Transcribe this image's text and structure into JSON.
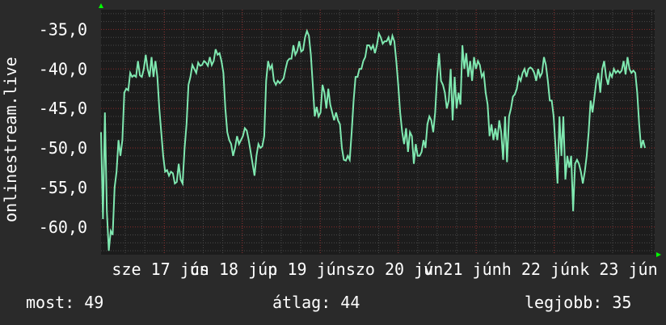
{
  "chart_data": {
    "type": "line",
    "ylabel": "onlinestream.live",
    "ylim": [
      -63.5,
      -32.5
    ],
    "y_ticks": [
      -35,
      -40,
      -45,
      -50,
      -55,
      -60
    ],
    "y_tick_labels": [
      "-35,0",
      "-40,0",
      "-45,0",
      "-50,0",
      "-55,0",
      "-60,0"
    ],
    "x_tick_labels": [
      "sze 17 jún",
      "cs 18 jún",
      "p 19 jún",
      "szo 20 jún",
      "v 21 jún",
      "h 22 jún",
      "k 23 jún"
    ],
    "grid": true,
    "colors": {
      "background": "#2a2a2a",
      "plot": "#1c1c1c",
      "grid": "#4a4a4a",
      "minor_grid": "#8a2a2a",
      "line": "#7fe8b0",
      "arrow": "#00ff00"
    },
    "series": [
      {
        "values": [
          -48,
          -59,
          -45.5,
          -58,
          -63,
          -60.5,
          -61,
          -55,
          -53,
          -49,
          -51,
          -49,
          -43,
          -42.5,
          -42.7,
          -40.5,
          -41,
          -40.8,
          -41,
          -39,
          -40.8,
          -41,
          -40,
          -38.2,
          -40,
          -41,
          -38.5,
          -41,
          -39,
          -41,
          -45,
          -48,
          -51,
          -53,
          -52.8,
          -53.5,
          -53,
          -53.2,
          -54.5,
          -54.3,
          -52,
          -54,
          -54.5,
          -50,
          -47,
          -42,
          -41,
          -39.5,
          -40,
          -40.5,
          -39.2,
          -39.6,
          -39.5,
          -39,
          -39.2,
          -39.6,
          -38.5,
          -39.5,
          -39,
          -37.5,
          -38.2,
          -38,
          -39,
          -40.5,
          -45,
          -48,
          -49,
          -49.5,
          -51,
          -50,
          -48.5,
          -49.5,
          -49,
          -48.5,
          -47.5,
          -47.8,
          -49,
          -50.5,
          -52,
          -53.5,
          -51,
          -49.5,
          -50,
          -49.8,
          -48.5,
          -41.5,
          -39,
          -40,
          -39.5,
          -41.5,
          -42,
          -41.5,
          -41.8,
          -41.5,
          -41.2,
          -40,
          -39,
          -38.7,
          -38.7,
          -37,
          -38.2,
          -37.7,
          -36.5,
          -37.8,
          -37.6,
          -36,
          -35.2,
          -35.8,
          -38.2,
          -42,
          -46,
          -44.8,
          -46,
          -45.5,
          -42,
          -43,
          -45,
          -42.5,
          -44.5,
          -45.5,
          -46.5,
          -45.5,
          -46.5,
          -47,
          -50,
          -51.5,
          -51.6,
          -51,
          -51.5,
          -48,
          -44,
          -41,
          -41,
          -40,
          -40,
          -39,
          -38.5,
          -37,
          -37,
          -37.5,
          -37,
          -38,
          -37,
          -35.5,
          -36,
          -36.8,
          -36.5,
          -36.5,
          -36,
          -37,
          -35.8,
          -36.5,
          -39,
          -42,
          -45.5,
          -48,
          -49.5,
          -47.5,
          -50.5,
          -48,
          -48.5,
          -52,
          -49.5,
          -51,
          -51,
          -50.5,
          -49,
          -50,
          -47,
          -46,
          -46.5,
          -48,
          -45.5,
          -41,
          -38,
          -41.5,
          -42,
          -43,
          -45,
          -44,
          -40,
          -46.5,
          -41,
          -45,
          -43,
          -44.5,
          -37,
          -40,
          -38,
          -41,
          -39,
          -41.5,
          -38.5,
          -40,
          -39,
          -39.5,
          -41,
          -40.5,
          -43,
          -44.5,
          -48.5,
          -47,
          -49,
          -47.5,
          -49,
          -46.5,
          -48,
          -51.5,
          -46,
          -51.8,
          -46,
          -45,
          -43.5,
          -43.2,
          -42.5,
          -41,
          -41.5,
          -40.5,
          -40,
          -41,
          -40,
          -39.8,
          -40,
          -40.5,
          -41.5,
          -40,
          -41,
          -40.5,
          -38.5,
          -39.5,
          -41.5,
          -44,
          -44,
          -46,
          -50,
          -54.5,
          -46,
          -51,
          -46,
          -54,
          -51,
          -52.5,
          -51,
          -58,
          -52,
          -51.5,
          -52,
          -53,
          -54.5,
          -53,
          -51,
          -48,
          -44,
          -45.5,
          -43.5,
          -41.5,
          -40.5,
          -43,
          -40,
          -39,
          -41,
          -42,
          -40.5,
          -41,
          -40,
          -40.5,
          -40.2,
          -40.5,
          -40.2,
          -39,
          -40.7,
          -38.5,
          -40,
          -40.5,
          -40.2,
          -40.5,
          -43,
          -47,
          -50,
          -49,
          -50
        ]
      }
    ],
    "arrows": [
      "x-axis-arrow",
      "y-axis-arrow"
    ]
  },
  "footer": {
    "now": "most: 49",
    "avg": "átlag: 44",
    "best": "legjobb: 35"
  }
}
